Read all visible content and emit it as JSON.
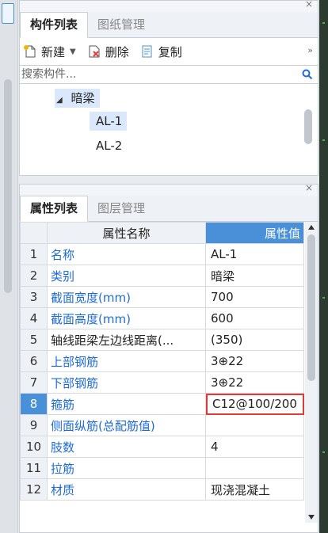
{
  "component_panel": {
    "close": "×",
    "tabs": [
      {
        "label": "构件列表"
      },
      {
        "label": "图纸管理"
      }
    ],
    "toolbar": {
      "new_label": "新建",
      "delete_label": "删除",
      "copy_label": "复制",
      "more": "»"
    },
    "search": {
      "placeholder": "搜索构件..."
    },
    "tree": {
      "arrow": "◢",
      "parent": "暗梁",
      "children": [
        {
          "label": "AL-1"
        },
        {
          "label": "AL-2"
        }
      ]
    }
  },
  "property_panel": {
    "close": "×",
    "tabs": [
      {
        "label": "属性列表"
      },
      {
        "label": "图层管理"
      }
    ],
    "headers": {
      "name": "属性名称",
      "value": "属性值"
    },
    "rows": [
      {
        "idx": "1",
        "name": "名称",
        "value": "AL-1"
      },
      {
        "idx": "2",
        "name": "类别",
        "value": "暗梁"
      },
      {
        "idx": "3",
        "name": "截面宽度(mm)",
        "value": "700"
      },
      {
        "idx": "4",
        "name": "截面高度(mm)",
        "value": "600"
      },
      {
        "idx": "5",
        "name": "轴线距梁左边线距离(...",
        "value": "(350)"
      },
      {
        "idx": "6",
        "name": "上部钢筋",
        "value": "3⊕22"
      },
      {
        "idx": "7",
        "name": "下部钢筋",
        "value": "3⊕22"
      },
      {
        "idx": "8",
        "name": "箍筋",
        "value": "C12@100/200"
      },
      {
        "idx": "9",
        "name": "侧面纵筋(总配筋值)",
        "value": ""
      },
      {
        "idx": "10",
        "name": "肢数",
        "value": "4"
      },
      {
        "idx": "11",
        "name": "拉筋",
        "value": ""
      },
      {
        "idx": "12",
        "name": "材质",
        "value": "现浇混凝土"
      }
    ]
  },
  "colors": {
    "accent": "#4a90d9",
    "selected_bg": "#dbe8fb",
    "edit_border": "#e53935",
    "link_text": "#1e6bd8"
  }
}
